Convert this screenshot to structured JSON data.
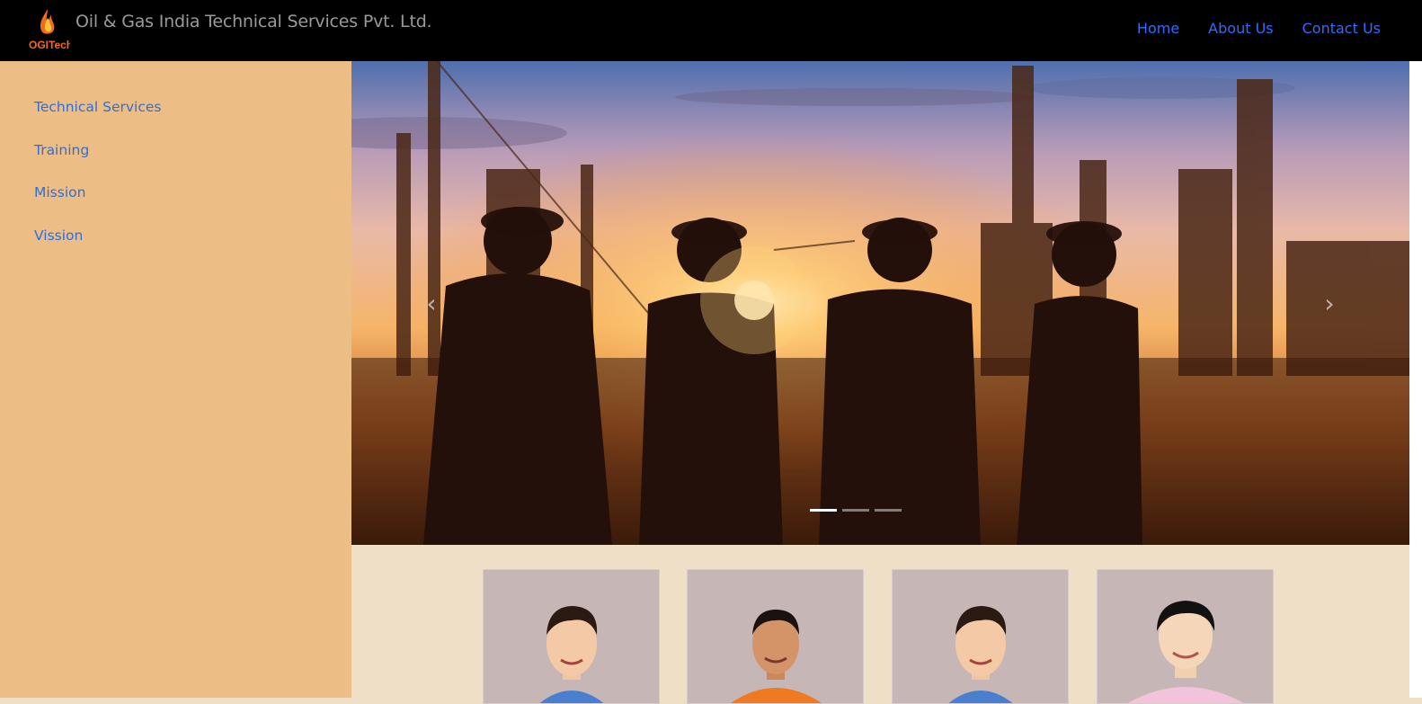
{
  "header": {
    "logo_text": "OGITech",
    "title": "Oil & Gas India Technical Services Pvt. Ltd.",
    "nav": [
      {
        "label": "Home"
      },
      {
        "label": "About Us"
      },
      {
        "label": "Contact Us"
      }
    ]
  },
  "sidebar": {
    "items": [
      {
        "label": "Technical Services"
      },
      {
        "label": "Training"
      },
      {
        "label": "Mission"
      },
      {
        "label": "Vission"
      }
    ]
  },
  "carousel": {
    "prev_icon": "chevron-left-icon",
    "next_icon": "chevron-right-icon",
    "slide_count": 3,
    "active_index": 0
  },
  "team_cards": [
    {
      "shirt": "#4a7fd0"
    },
    {
      "shirt": "#f07a22"
    },
    {
      "shirt": "#4a7fd0"
    },
    {
      "shirt": "#f3c3dc"
    }
  ],
  "colors": {
    "navbar": "#000000",
    "sidebar": "#ecbd85",
    "link": "#2f6bff",
    "content_bg": "#efdfc6"
  }
}
